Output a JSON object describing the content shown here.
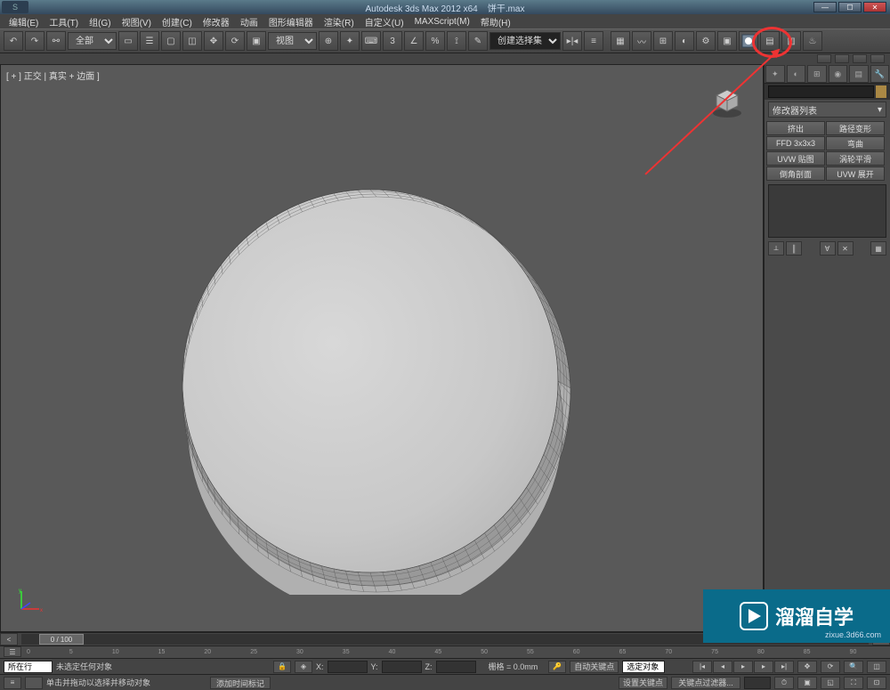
{
  "title": {
    "app": "Autodesk 3ds Max  2012 x64",
    "file": "饼干.max"
  },
  "menu": [
    "编辑(E)",
    "工具(T)",
    "组(G)",
    "视图(V)",
    "创建(C)",
    "修改器",
    "动画",
    "图形编辑器",
    "渲染(R)",
    "自定义(U)",
    "MAXScript(M)",
    "帮助(H)"
  ],
  "filter": "全部",
  "view_label": "视图",
  "selection_set": "创建选择集",
  "viewport_label": "[ + ] 正交 | 真实 + 边面 ]",
  "command_panel": {
    "modifier_list": "修改器列表",
    "buttons": [
      "挤出",
      "路径变形",
      "FFD 3x3x3",
      "弯曲",
      "UVW 贴图",
      "涡轮平滑",
      "倒角剖面",
      "UVW 展开"
    ]
  },
  "time": {
    "slider": "0 / 100"
  },
  "ruler": [
    "0",
    "5",
    "10",
    "15",
    "20",
    "25",
    "30",
    "35",
    "40",
    "45",
    "50",
    "55",
    "60",
    "65",
    "70",
    "75",
    "80",
    "85",
    "90"
  ],
  "status": {
    "nosel": "未选定任何对象",
    "hint": "单击并拖动以选择并移动对象",
    "x": "X:",
    "y": "Y:",
    "z": "Z:",
    "grid": "栅格 = 0.0mm",
    "autokey": "自动关键点",
    "selset": "选定对象",
    "setkey": "设置关键点",
    "keyfilter": "关键点过滤器...",
    "addtime": "添加时间标记",
    "row": "所在行"
  },
  "watermark": {
    "text": "溜溜自学",
    "sub": "zixue.3d66.com"
  }
}
